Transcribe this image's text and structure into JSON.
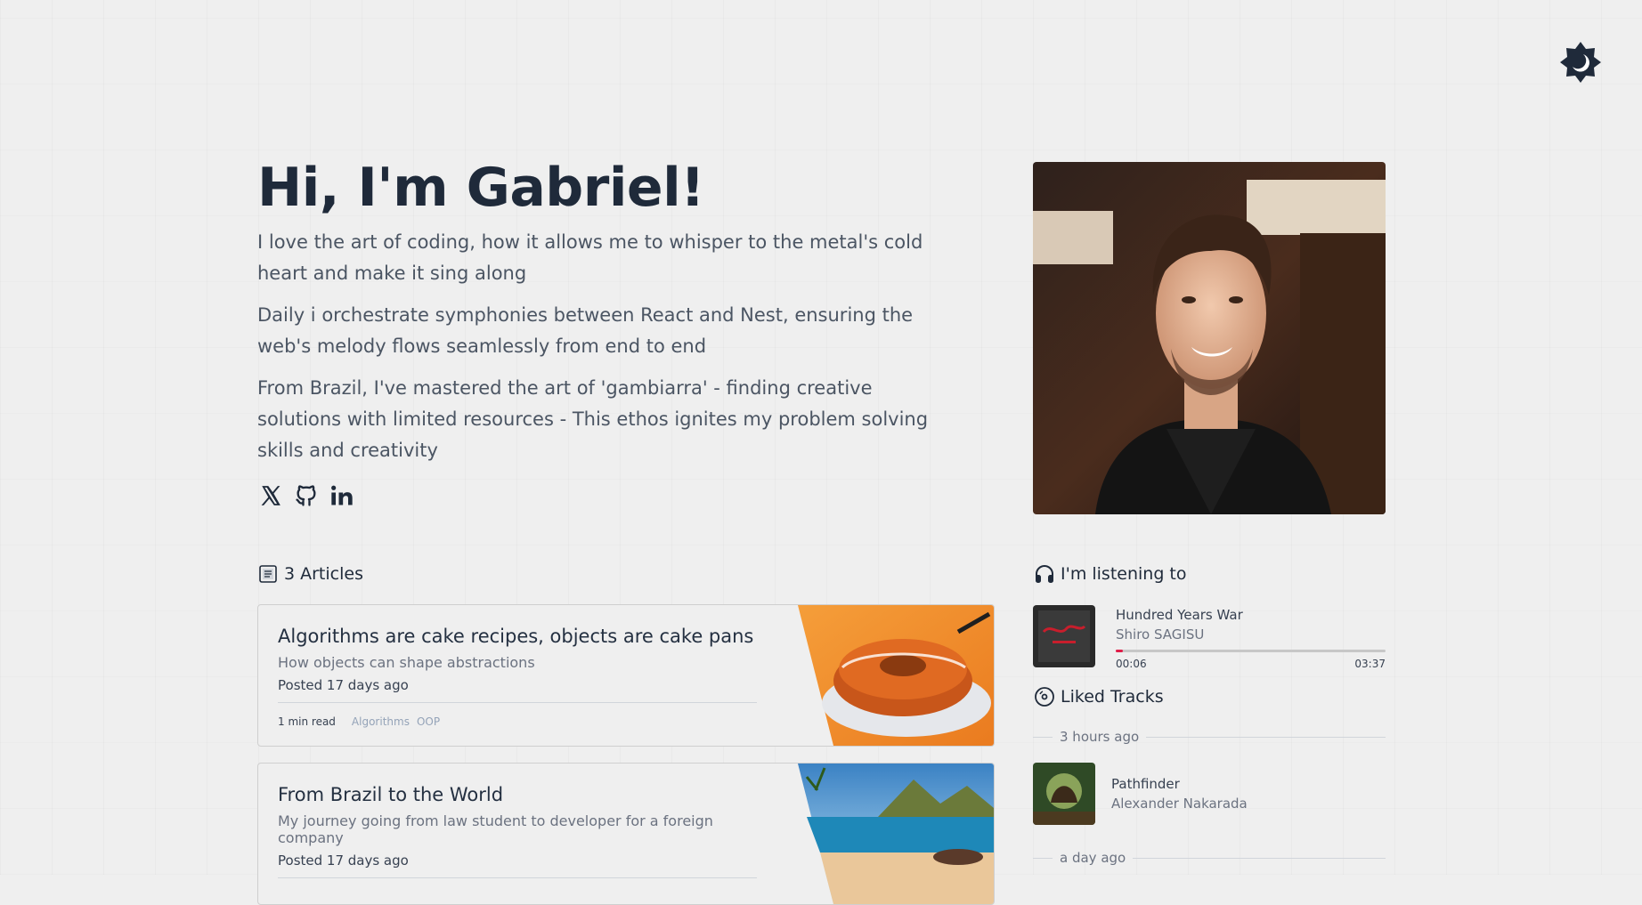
{
  "hero": {
    "title": "Hi, I'm Gabriel!",
    "paragraphs": [
      "I love the art of coding, how it allows me to whisper to the metal's cold heart and make it sing along",
      "Daily i orchestrate symphonies between React and Nest, ensuring the web's melody flows seamlessly from end to end",
      "From Brazil, I've mastered the art of 'gambiarra' - finding creative solutions with limited resources - This ethos ignites my problem solving skills and creativity"
    ],
    "socials": [
      "x-icon",
      "github-icon",
      "linkedin-icon"
    ]
  },
  "theme_toggle": {
    "icon": "moon-icon"
  },
  "portrait": {
    "icon": "portrait-image"
  },
  "articles": {
    "title": "3 Articles",
    "items": [
      {
        "title": "Algorithms are cake recipes, objects are cake pans",
        "subtitle": "How objects can shape abstractions",
        "posted": "Posted 17 days ago",
        "read_time": "1 min read",
        "tags": [
          "Algorithms",
          "OOP"
        ]
      },
      {
        "title": "From Brazil to the World",
        "subtitle": "My journey going from law student to developer for a foreign company",
        "posted": "Posted 17 days ago"
      }
    ]
  },
  "listening": {
    "title": "I'm listening to",
    "track": {
      "title": "Hundred Years War",
      "artist": "Shiro SAGISU",
      "elapsed": "00:06",
      "duration": "03:37",
      "progress": 0.028
    }
  },
  "liked": {
    "title": "Liked Tracks",
    "groups": [
      {
        "label": "3 hours ago",
        "tracks": [
          {
            "title": "Pathfinder",
            "artist": "Alexander Nakarada"
          }
        ]
      },
      {
        "label": "a day ago"
      }
    ]
  },
  "colors": {
    "background": "#efefef",
    "heading": "#1f2a3a",
    "body_text": "#4b5563",
    "progress_fill": "#e11d48",
    "tag": "#94a3b8"
  }
}
